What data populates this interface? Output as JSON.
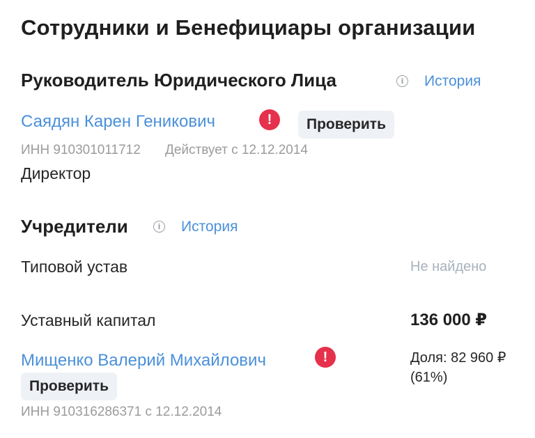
{
  "page": {
    "title": "Сотрудники и Бенефициары организации"
  },
  "head_section": {
    "title": "Руководитель Юридического Лица",
    "info_icon": "info-icon",
    "history_label": "История",
    "person": {
      "name": "Саядян Карен Геникович",
      "alert_icon": "exclamation-icon",
      "check_label": "Проверить",
      "inn": "ИНН 910301011712",
      "since": "Действует с 12.12.2014",
      "role": "Директор"
    }
  },
  "founders_section": {
    "title": "Учредители",
    "info_icon": "info-icon",
    "history_label": "История",
    "charter": {
      "label": "Типовой устав",
      "value": "Не найдено"
    },
    "capital": {
      "label": "Уставный капитал",
      "value": "136 000 ₽"
    },
    "founder": {
      "name": "Мищенко Валерий Михайлович",
      "alert_icon": "exclamation-icon",
      "check_label": "Проверить",
      "share_line1": "Доля: 82 960 ₽",
      "share_line2": "(61%)",
      "inn_since": "ИНН 910316286371 с 12.12.2014"
    }
  },
  "colors": {
    "link": "#4a90d9",
    "alert": "#e5314b",
    "button_bg": "#eef1f5",
    "muted": "#9b9b9b"
  }
}
